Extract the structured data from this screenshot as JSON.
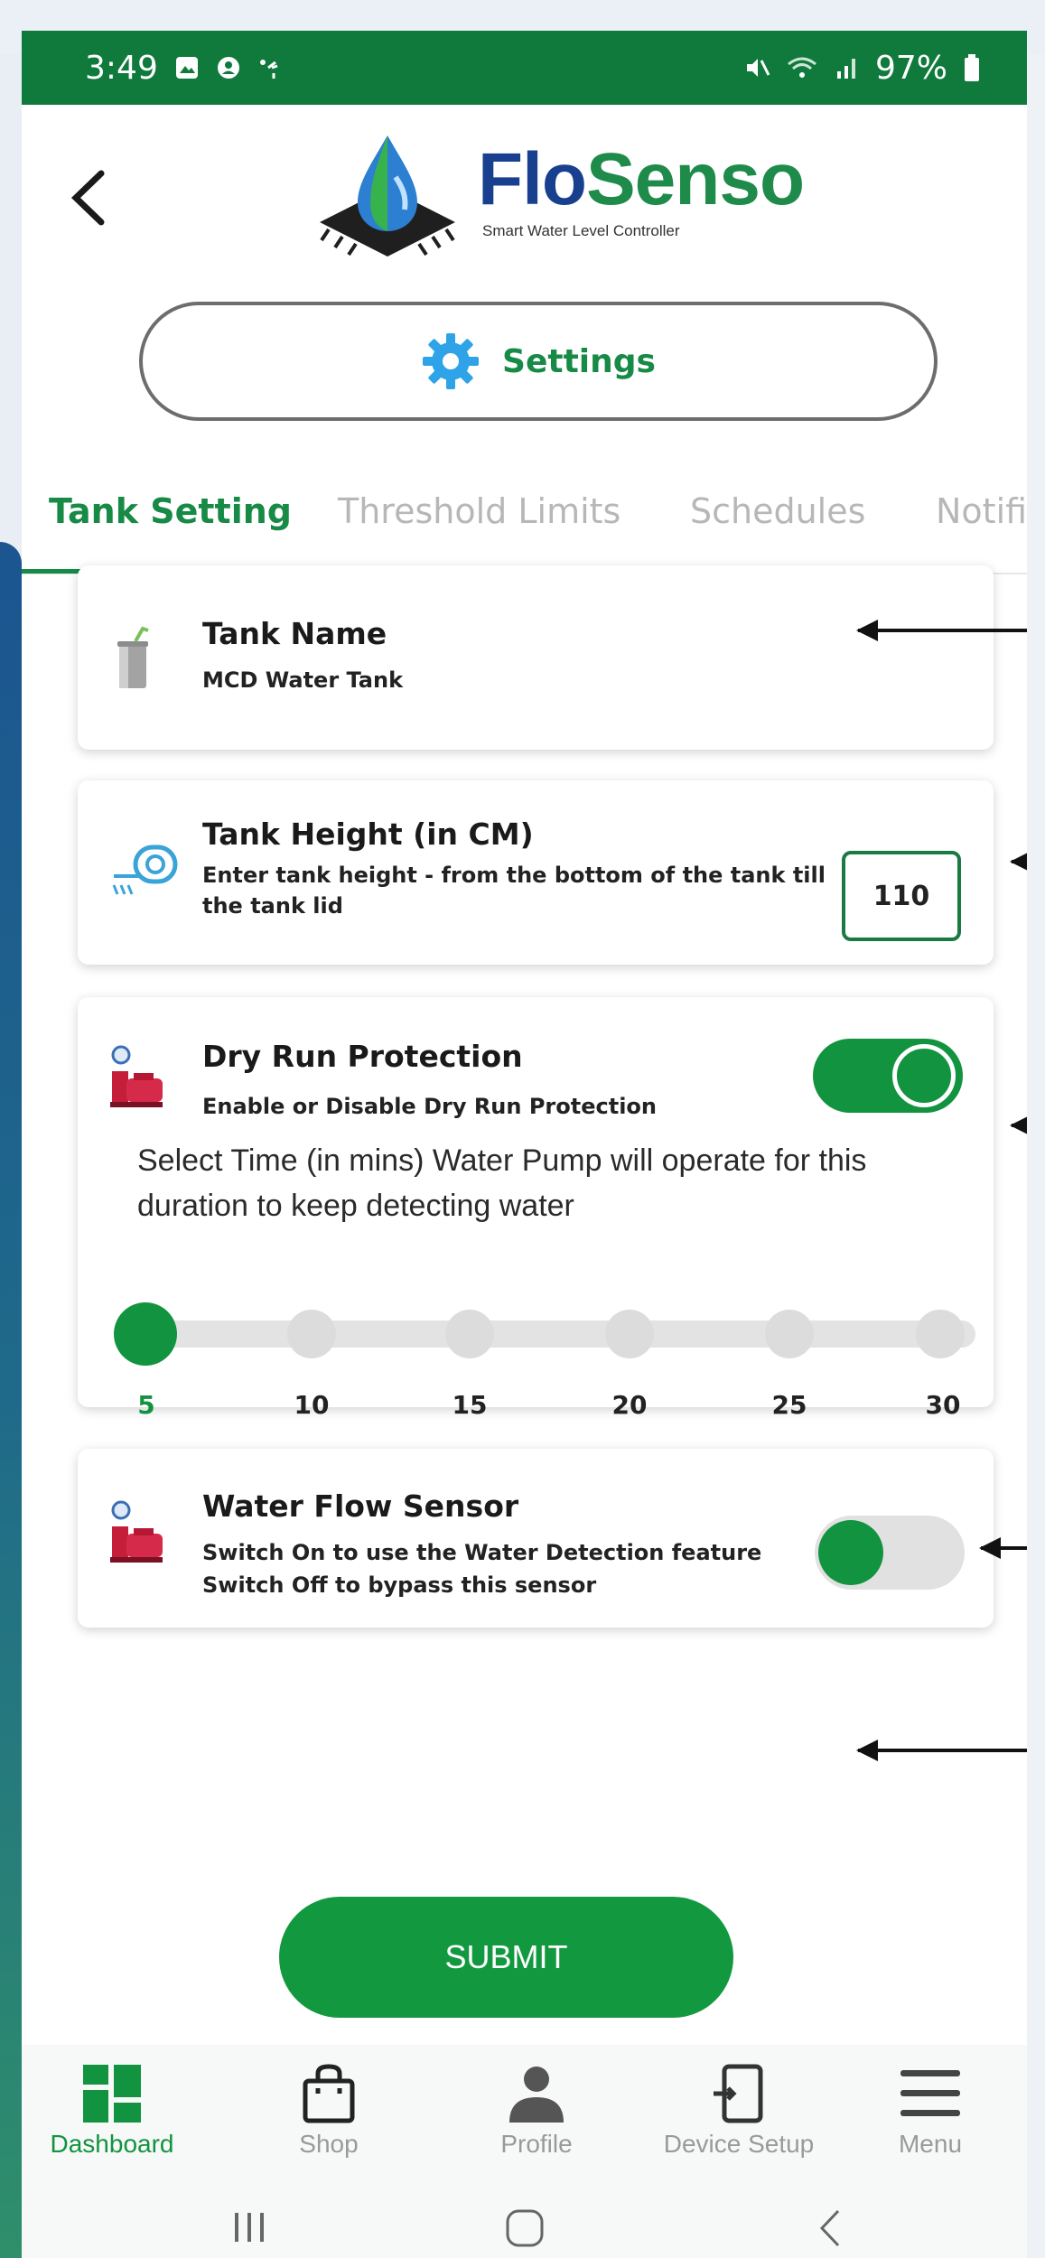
{
  "status_bar": {
    "time": "3:49",
    "battery": "97%"
  },
  "header": {
    "logo_flo": "Flo",
    "logo_senso": "Senso",
    "logo_subtitle": "Smart Water Level Controller",
    "settings_label": "Settings"
  },
  "tabs": [
    {
      "label": "Tank Setting",
      "active": true
    },
    {
      "label": "Threshold Limits",
      "active": false
    },
    {
      "label": "Schedules",
      "active": false
    },
    {
      "label": "Notific",
      "active": false
    }
  ],
  "tank_name": {
    "title": "Tank Name",
    "value": "MCD Water Tank"
  },
  "tank_height": {
    "title": "Tank Height (in CM)",
    "description": "Enter tank height - from the bottom of the tank till the tank lid",
    "value": "110"
  },
  "dry_run": {
    "title": "Dry Run Protection",
    "subtitle": "Enable or Disable Dry Run Protection",
    "enabled": true,
    "description": "Select Time (in mins) Water Pump will operate for this duration to keep detecting water",
    "options": [
      "5",
      "10",
      "15",
      "20",
      "25",
      "30"
    ],
    "selected": "5"
  },
  "water_flow": {
    "title": "Water Flow Sensor",
    "line1": "Switch On to use the Water Detection feature",
    "line2": "Switch Off to bypass this sensor",
    "enabled": false
  },
  "submit_label": "SUBMIT",
  "bottom_nav": [
    {
      "label": "Dashboard",
      "icon": "dashboard-icon",
      "active": true
    },
    {
      "label": "Shop",
      "icon": "shopping-bag-icon",
      "active": false
    },
    {
      "label": "Profile",
      "icon": "person-icon",
      "active": false
    },
    {
      "label": "Device Setup",
      "icon": "device-setup-icon",
      "active": false
    },
    {
      "label": "Menu",
      "icon": "hamburger-menu-icon",
      "active": false
    }
  ],
  "colors": {
    "brand_green": "#12933f",
    "status_bar": "#0f7a3c",
    "brand_blue": "#19408e"
  }
}
